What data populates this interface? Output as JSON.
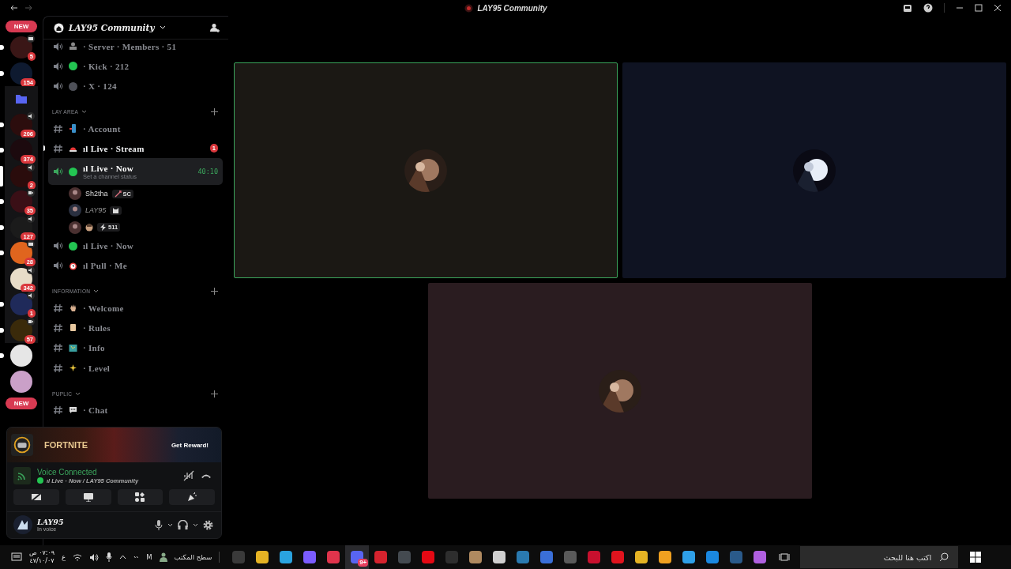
{
  "window": {
    "title": "LAY95 Community"
  },
  "servers": [
    {
      "kind": "pill",
      "label": "NEW",
      "selected": false,
      "unread": false,
      "grouped": false
    },
    {
      "kind": "server",
      "color": "#3a1616",
      "badge": "5",
      "activity": {
        "kind": "screen"
      },
      "grouped": false,
      "selected": false,
      "unread": true
    },
    {
      "kind": "server",
      "color": "#0e1a30",
      "badge": "154",
      "grouped": false,
      "selected": false,
      "unread": true
    },
    {
      "kind": "folder",
      "color": "#5865f2",
      "grouped": true,
      "selected": false,
      "unread": false
    },
    {
      "kind": "server",
      "color": "#2c0d0d",
      "badge": "206",
      "activity": {
        "kind": "voice"
      },
      "grouped": true,
      "selected": false,
      "unread": true
    },
    {
      "kind": "server",
      "color": "#1c0a0e",
      "badge": "374",
      "grouped": true,
      "selected": false,
      "unread": true
    },
    {
      "kind": "server",
      "color": "#2a0c0c",
      "badge": "2",
      "activity": {
        "kind": "voice"
      },
      "grouped": true,
      "selected": true,
      "unread": false
    },
    {
      "kind": "server",
      "color": "#3a0f16",
      "badge": "35",
      "activity": {
        "kind": "video"
      },
      "grouped": true,
      "selected": false,
      "unread": true
    },
    {
      "kind": "server",
      "color": "#1b1b1b",
      "badge": "127",
      "activity": {
        "kind": "voice"
      },
      "grouped": true,
      "selected": false,
      "unread": true
    },
    {
      "kind": "server",
      "color": "#e0651e",
      "badge": "28",
      "activity": {
        "kind": "screen"
      },
      "grouped": true,
      "selected": false,
      "unread": true
    },
    {
      "kind": "server",
      "color": "#e8dcc8",
      "badge": "342",
      "activity": {
        "kind": "voice"
      },
      "grouped": true,
      "selected": false,
      "unread": false
    },
    {
      "kind": "server",
      "color": "#1f2a5a",
      "badge": "1",
      "activity": {
        "kind": "voice"
      },
      "grouped": true,
      "selected": false,
      "unread": true
    },
    {
      "kind": "server",
      "color": "#3a2a0a",
      "badge": "57",
      "activity": {
        "kind": "video"
      },
      "grouped": true,
      "selected": false,
      "unread": true
    },
    {
      "kind": "server",
      "color": "#e6e6e6",
      "grouped": false,
      "selected": false,
      "unread": true
    },
    {
      "kind": "server",
      "color": "#caa0c8",
      "grouped": false,
      "selected": false,
      "unread": false
    },
    {
      "kind": "pill",
      "label": "NEW",
      "selected": false,
      "unread": false,
      "grouped": false
    }
  ],
  "server_header": {
    "name": "LAY95 Community"
  },
  "top_channels": [
    {
      "kind": "voice",
      "icon": {
        "kind": "person"
      },
      "name": "· Server · Members · 51",
      "unread": false,
      "selected": false
    },
    {
      "kind": "voice",
      "icon": {
        "kind": "dot",
        "color": "#23c552"
      },
      "name": "· Kick · 212",
      "unread": false,
      "selected": false
    },
    {
      "kind": "voice",
      "icon": {
        "kind": "dot",
        "color": "#4e5058"
      },
      "name": "· X · 124",
      "unread": false,
      "selected": false
    }
  ],
  "categories": [
    {
      "label": "LAY AREA",
      "channels": [
        {
          "kind": "text",
          "icon": {
            "kind": "phone"
          },
          "name": "· Account",
          "unread": false,
          "selected": false
        },
        {
          "kind": "text",
          "icon": {
            "kind": "siren"
          },
          "name": "ıl Live · Stream",
          "unread": true,
          "selected": false,
          "mention": "1"
        },
        {
          "kind": "voice",
          "icon": {
            "kind": "dot",
            "color": "#23c552"
          },
          "name": "ıl Live · Now",
          "unread": true,
          "selected": true,
          "timer": "40:10",
          "status_placeholder": "Set a channel status",
          "members": [
            {
              "name": "Sh2tha",
              "self": false,
              "tag": "SC",
              "tag_icon": {
                "kind": "sword"
              }
            },
            {
              "name": "LAY95",
              "self": true,
              "tag_icon": {
                "kind": "cat"
              }
            },
            {
              "name_emoji": true,
              "self": false,
              "tag": "511",
              "tag_icon": {
                "kind": "bolt"
              }
            }
          ]
        },
        {
          "kind": "voice",
          "icon": {
            "kind": "dot",
            "color": "#23c552"
          },
          "name": "ıl Live · Now",
          "unread": false,
          "selected": false
        },
        {
          "kind": "voice",
          "icon": {
            "kind": "alarm"
          },
          "name": "ıl Pull · Me",
          "unread": false,
          "selected": false
        }
      ]
    },
    {
      "label": "INFORMATION",
      "channels": [
        {
          "kind": "text",
          "icon": {
            "kind": "hand"
          },
          "name": "· Welcome",
          "unread": false,
          "selected": false
        },
        {
          "kind": "text",
          "icon": {
            "kind": "scroll"
          },
          "name": "· Rules",
          "unread": false,
          "selected": false
        },
        {
          "kind": "text",
          "icon": {
            "kind": "map"
          },
          "name": "· Info",
          "unread": false,
          "selected": false
        },
        {
          "kind": "text",
          "icon": {
            "kind": "sparkles"
          },
          "name": "· Level",
          "unread": false,
          "selected": false
        }
      ]
    },
    {
      "label": "PUPLIC",
      "channels": [
        {
          "kind": "text",
          "icon": {
            "kind": "speech"
          },
          "name": "· Chat",
          "unread": false,
          "selected": false
        }
      ]
    }
  ],
  "promo": {
    "title": "FORTNITE",
    "button": "Get Reward!"
  },
  "voice": {
    "status": "Voice Connected",
    "channel": "ıl Live · Now / LAY95 Community"
  },
  "user": {
    "name": "LAY95",
    "status": "In voice"
  },
  "tiles": [
    {
      "speaking": true,
      "color": "#1b1814"
    },
    {
      "speaking": false,
      "color": "#0f1322"
    },
    {
      "speaking": false,
      "color": "#2a1c20"
    }
  ],
  "taskbar": {
    "time": "٠٧:٠٩ ص",
    "date": "٤٧/١٠/٠٧",
    "language": "ع",
    "account": "M",
    "desktop": "سطح المكتب",
    "search_placeholder": "اكتب هنا للبحث",
    "apps": [
      {
        "color": "#3a3a3a",
        "active": false
      },
      {
        "color": "#e5b324",
        "active": false
      },
      {
        "color": "#2aa3df",
        "active": false
      },
      {
        "color": "#7b5cff",
        "active": false
      },
      {
        "color": "#e0344c",
        "active": false
      },
      {
        "color": "#5865f2",
        "active": true,
        "badge": "9+"
      },
      {
        "color": "#d6232e",
        "active": false
      },
      {
        "color": "#444a50",
        "active": false
      },
      {
        "color": "#e50914",
        "active": false
      },
      {
        "color": "#2e2e2e",
        "active": false
      },
      {
        "color": "#b08a60",
        "active": false
      },
      {
        "color": "#d0d0d0",
        "active": false
      },
      {
        "color": "#2a7ab0",
        "active": false
      },
      {
        "color": "#3a6fd8",
        "active": false
      },
      {
        "color": "#5a5a5a",
        "active": false
      },
      {
        "color": "#c8102e",
        "active": false
      },
      {
        "color": "#e0141e",
        "active": false
      },
      {
        "color": "#e5b324",
        "active": false
      },
      {
        "color": "#f0a020",
        "active": false
      },
      {
        "color": "#2fa0e8",
        "active": false
      },
      {
        "color": "#1a88e0",
        "active": false
      },
      {
        "color": "#2a5a8a",
        "active": false
      },
      {
        "color": "#b060e0",
        "active": false
      }
    ]
  }
}
